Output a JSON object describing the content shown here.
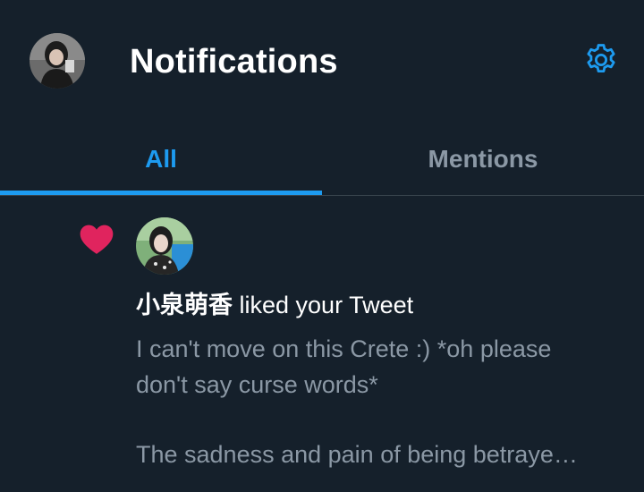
{
  "header": {
    "title": "Notifications",
    "avatar_icon": "user-avatar",
    "settings_icon": "gear-icon"
  },
  "tabs": [
    {
      "label": "All",
      "active": true
    },
    {
      "label": "Mentions",
      "active": false
    }
  ],
  "notification": {
    "type_icon": "heart-icon",
    "user_name": "小泉萌香",
    "action": " liked your Tweet",
    "tweet_lines": [
      "I can't move on this Crete :) *oh please",
      "don't say curse words*",
      "",
      "The sadness and pain of being betraye…"
    ]
  },
  "colors": {
    "background": "#15202b",
    "accent": "#1d9bf0",
    "heart": "#e0245e",
    "muted_text": "#8b98a5",
    "divider": "#38444d"
  }
}
